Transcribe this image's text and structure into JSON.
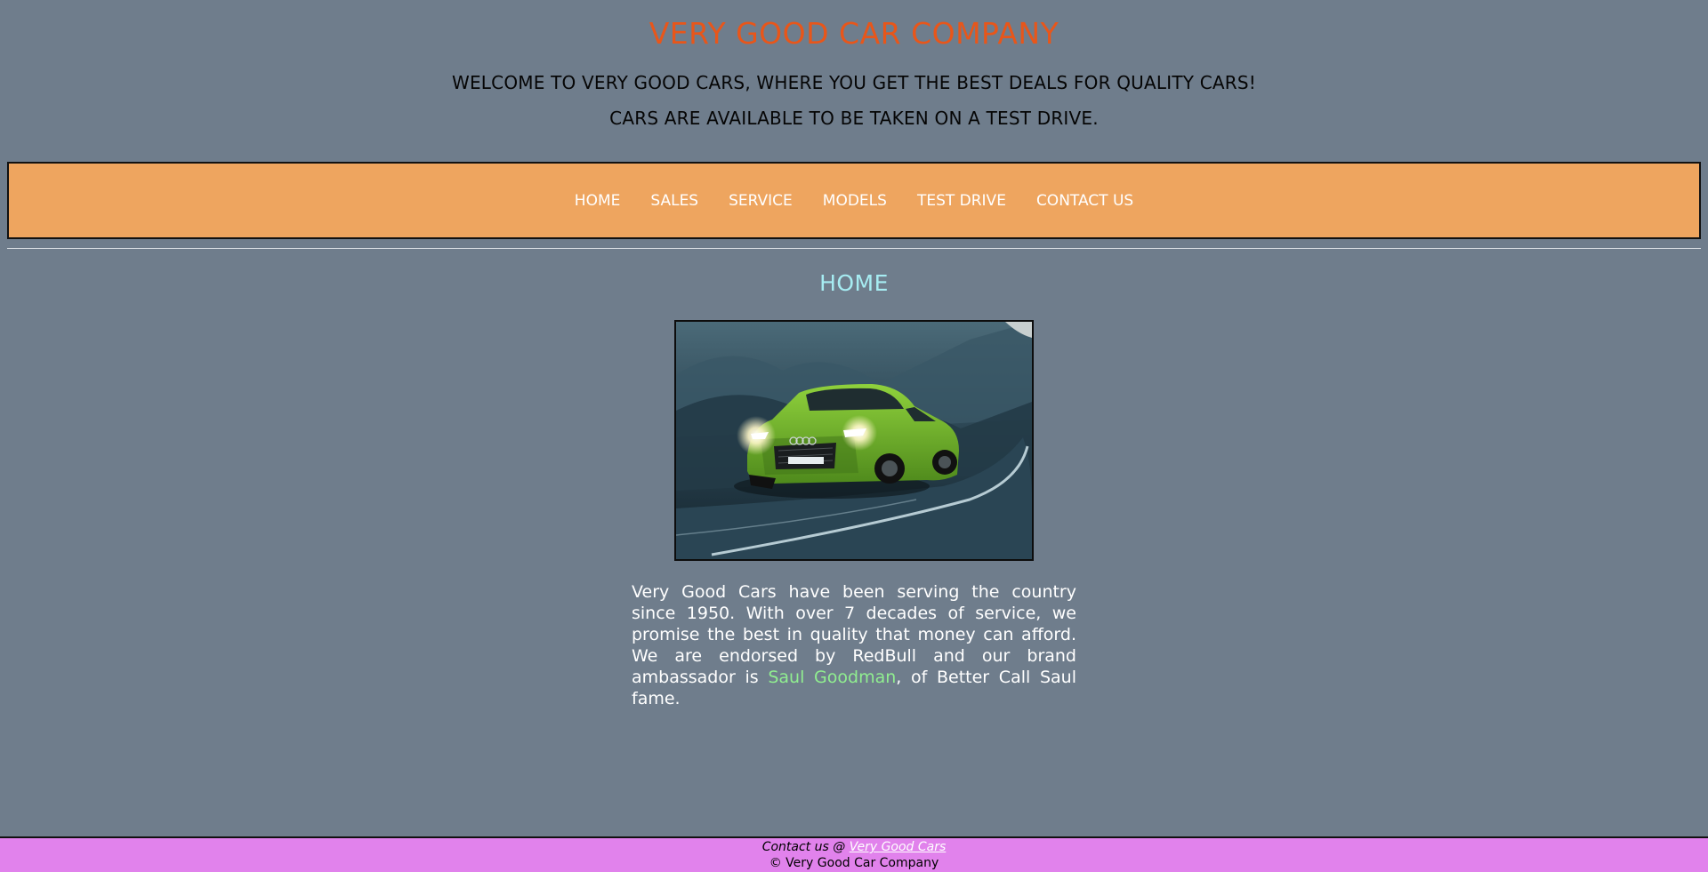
{
  "header": {
    "title": "VERY GOOD CAR COMPANY",
    "welcome_line_1": "WELCOME TO VERY GOOD CARS, WHERE YOU GET THE BEST DEALS FOR QUALITY CARS!",
    "welcome_line_2": "CARS ARE AVAILABLE TO BE TAKEN ON A TEST DRIVE."
  },
  "nav": {
    "items": [
      {
        "label": "HOME"
      },
      {
        "label": "SALES"
      },
      {
        "label": "SERVICE"
      },
      {
        "label": "MODELS"
      },
      {
        "label": "TEST DRIVE"
      },
      {
        "label": "CONTACT US"
      }
    ]
  },
  "main": {
    "heading": "HOME",
    "image_subject": "green-suv-on-mountain-road",
    "about_before": "Very Good Cars have been serving the country since 1950. With over 7 decades of service, we promise the best in quality that money can afford. We are endorsed by RedBull and our brand ambassador is ",
    "about_link": "Saul Goodman",
    "about_after": ", of Better Call Saul fame."
  },
  "footer": {
    "contact_prefix": "Contact us @ ",
    "contact_link": "Very Good Cars",
    "copyright": "© Very Good Car Company"
  },
  "colors": {
    "page_background": "#6f7d8c",
    "title": "#e8561a",
    "navbar": "#eea55f",
    "heading": "#a6ecf2",
    "link_green": "#90ee90",
    "footer": "#e182ec"
  }
}
